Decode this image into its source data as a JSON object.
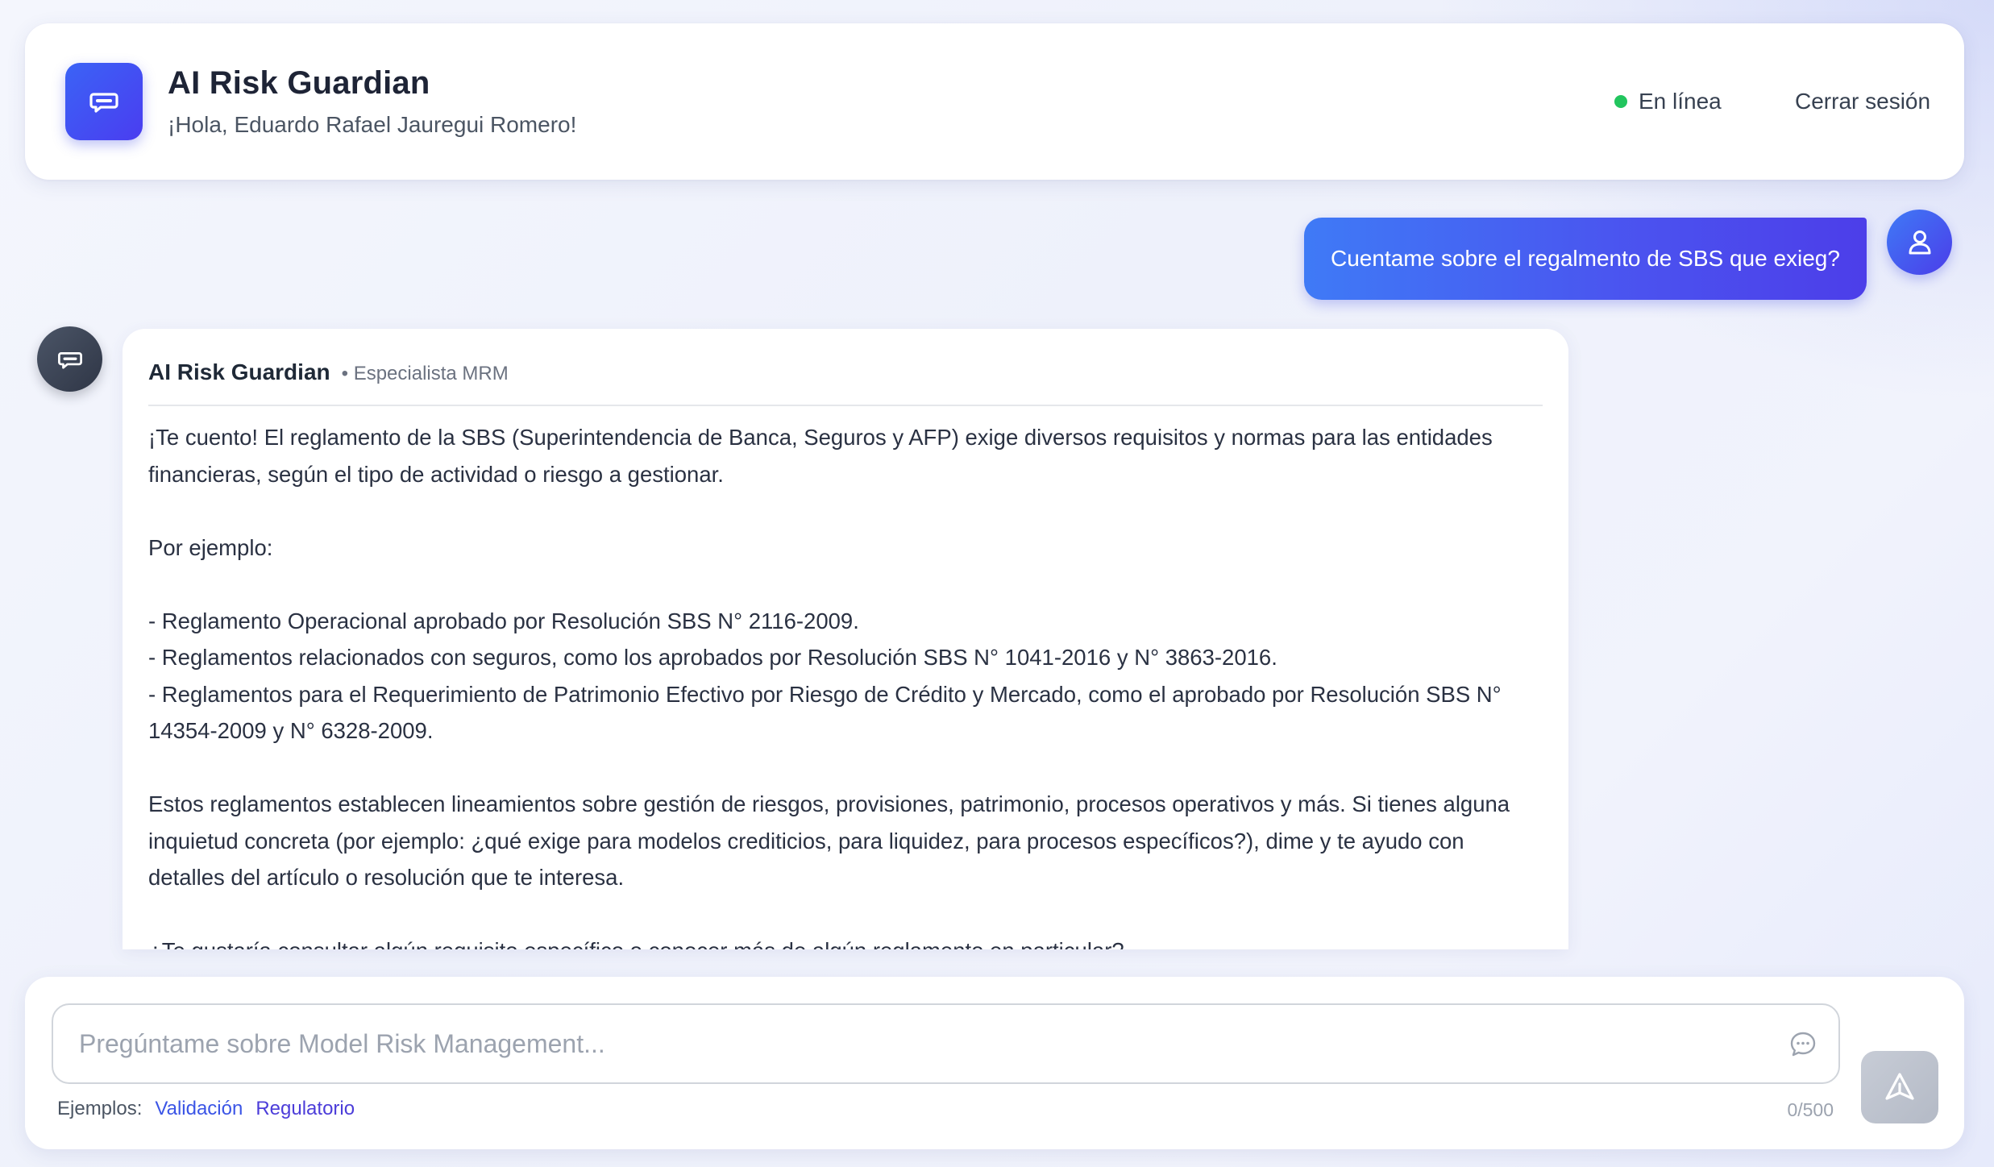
{
  "header": {
    "title": "AI Risk Guardian",
    "greeting": "¡Hola, Eduardo Rafael Jauregui Romero!",
    "status_label": "En línea",
    "logout_label": "Cerrar sesión",
    "colors": {
      "accent": "#4a4ef0",
      "status_online": "#22c55e"
    },
    "logo_icon": "chat-bubble-icon"
  },
  "messages": {
    "user": {
      "text": "Cuentame sobre el regalmento de SBS que exieg?",
      "avatar_icon": "user-icon"
    },
    "bot": {
      "name": "AI Risk Guardian",
      "role": "• Especialista MRM",
      "avatar_icon": "chat-bubble-icon",
      "paragraphs": [
        "¡Te cuento! El reglamento de la SBS (Superintendencia de Banca, Seguros y AFP) exige diversos requisitos y normas para las entidades financieras, según el tipo de actividad o riesgo a gestionar.",
        "Por ejemplo:",
        "- Reglamento Operacional aprobado por Resolución SBS N° 2116-2009.",
        "- Reglamentos relacionados con seguros, como los aprobados por Resolución SBS N° 1041-2016 y N° 3863-2016.",
        "- Reglamentos para el Requerimiento de Patrimonio Efectivo por Riesgo de Crédito y Mercado, como el aprobado por Resolución SBS N° 14354-2009 y N° 6328-2009.",
        "Estos reglamentos establecen lineamientos sobre gestión de riesgos, provisiones, patrimonio, procesos operativos y más. Si tienes alguna inquietud concreta (por ejemplo: ¿qué exige para modelos crediticios, para liquidez, para procesos específicos?), dime y te ayudo con detalles del artículo o resolución que te interesa.",
        "¿Te gustaría consultar algún requisito específico o conocer más de algún reglamento en particular?"
      ]
    }
  },
  "composer": {
    "placeholder": "Pregúntame sobre Model Risk Management...",
    "value": "",
    "examples_label": "Ejemplos:",
    "examples": [
      "Validación",
      "Regulatorio"
    ],
    "char_counter": "0/500",
    "send_icon": "send-icon",
    "input_icon": "chat-icon"
  }
}
